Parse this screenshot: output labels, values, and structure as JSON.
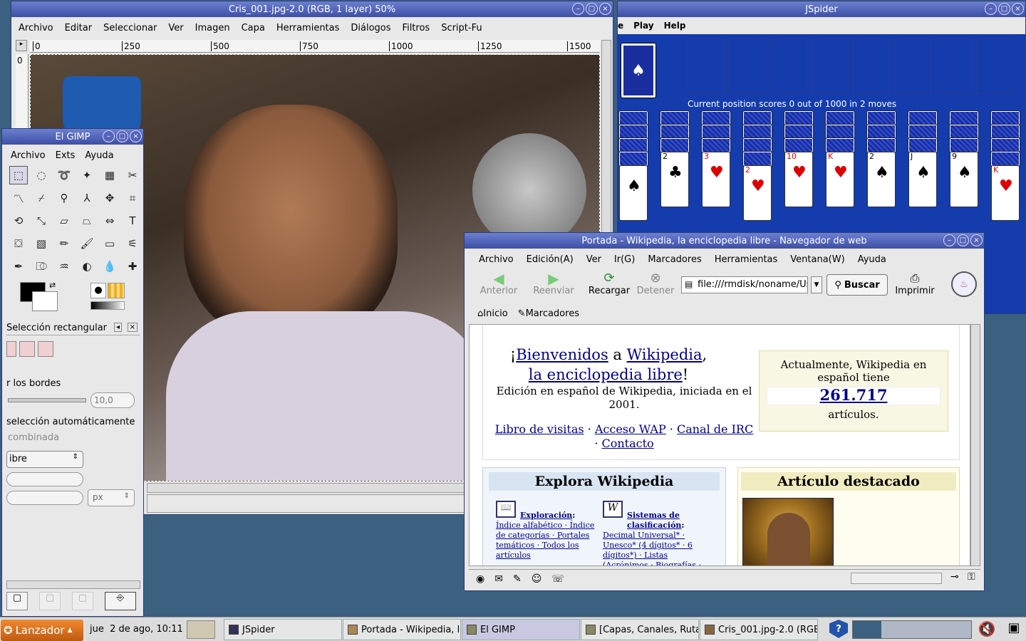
{
  "gimp_image": {
    "title": "Cris_001.jpg-2.0 (RGB, 1 layer) 50%",
    "menu": [
      "Archivo",
      "Editar",
      "Seleccionar",
      "Ver",
      "Imagen",
      "Capa",
      "Herramientas",
      "Diálogos",
      "Filtros",
      "Script-Fu"
    ],
    "ruler_labels": [
      "0",
      "250",
      "500",
      "750",
      "1000",
      "1250",
      "1500"
    ],
    "vruler_label": "0"
  },
  "jspider": {
    "title": "JSpider",
    "menu": [
      "e",
      "Play",
      "Help"
    ],
    "status": "Current position scores 0 out of 1000 in 2 moves",
    "columns": [
      {
        "rank": "",
        "suit": "♠"
      },
      {
        "rank": "2",
        "suit": "♣"
      },
      {
        "rank": "3",
        "suit": "♥"
      },
      {
        "rank": "2",
        "suit": "♥"
      },
      {
        "rank": "10",
        "suit": "♥"
      },
      {
        "rank": "K",
        "suit": "♥"
      },
      {
        "rank": "2",
        "suit": "♠"
      },
      {
        "rank": "J",
        "suit": "♠"
      },
      {
        "rank": "9",
        "suit": "♠"
      },
      {
        "rank": "K",
        "suit": "♥"
      }
    ]
  },
  "gimp_toolbox": {
    "title": "El GIMP",
    "menu": [
      "Archivo",
      "Exts",
      "Ayuda"
    ],
    "tools": [
      "rect-select",
      "ellipse-select",
      "lasso",
      "fuzzy-select",
      "by-color",
      "scissors",
      "paths",
      "color-picker",
      "zoom",
      "measure",
      "move",
      "crop",
      "rotate",
      "scale",
      "shear",
      "perspective",
      "flip",
      "text",
      "bucket",
      "blend",
      "pencil",
      "paintbrush",
      "eraser",
      "airbrush",
      "ink",
      "clone",
      "smudge",
      "dodge",
      "convolve",
      "heal"
    ],
    "options_title": "Selección rectangular",
    "feather_label": "r los bordes",
    "feather_value": "10,0",
    "autoshrink_label": "selección automáticamente",
    "combined_label": "combinada",
    "mode_value": "ibre",
    "unit_value": "px"
  },
  "browser": {
    "title": "Portada - Wikipedia, la enciclopedia libre - Navegador de web",
    "menu": [
      "Archivo",
      "Edición(A)",
      "Ver",
      "Ir(G)",
      "Marcadores",
      "Herramientas",
      "Ventana(W)",
      "Ayuda"
    ],
    "toolbar": {
      "back": "Anterior",
      "forward": "Reenviar",
      "reload": "Recargar",
      "stop": "Detener",
      "search": "Buscar",
      "print": "Imprimir"
    },
    "url": "file:///rmdisk/noname/Us",
    "bookmarks": [
      "Inicio",
      "Marcadores"
    ],
    "page": {
      "welcome_pre": "¡",
      "welcome_link1": "Bienvenidos",
      "welcome_a": " a ",
      "welcome_link2": "Wikipedia",
      "welcome_comma": ",",
      "welcome_link3": "la enciclopedia libre",
      "welcome_end": "!",
      "edition": "Edición en español de Wikipedia, iniciada en el 2001.",
      "links": [
        "Libro de visitas",
        "Acceso WAP",
        "Canal de IRC",
        "Contacto"
      ],
      "stats_intro": "Actualmente, Wikipedia en español tiene",
      "stats_count": "261.717",
      "stats_unit": "artículos.",
      "explore_title": "Explora Wikipedia",
      "featured_title": "Artículo destacado",
      "exploracion_head": "Exploración",
      "exploracion_text": "Índice alfabético · Índice de categorías · Portales temáticos · Todos los artículos",
      "sistemas_head": "Sistemas de clasificación",
      "sistemas_text": "Decimal Universal* · Unesco* (4 dígitos* · 6 dígitos*) · Listas (Acrónimos · Biografías ·"
    }
  },
  "taskbar": {
    "launcher": "Lanzador",
    "clock": "jue  2 de ago, 10:11",
    "tasks": [
      "JSpider",
      "Portada - Wikipedia, la",
      "El GIMP",
      "[Capas, Canales, Ruta",
      "Cris_001.jpg-2.0 (RGB,"
    ]
  }
}
